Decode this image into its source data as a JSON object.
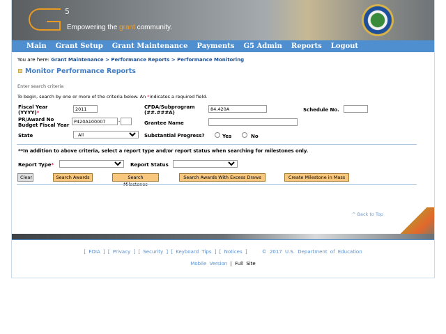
{
  "header": {
    "logo_text": "G5",
    "tagline_pre": "Empowering the ",
    "tagline_accent": "grant",
    "tagline_post": " community.",
    "seal": "U.S. Department of Education seal"
  },
  "nav": [
    "Main",
    "Grant Setup",
    "Grant Maintenance",
    "Payments",
    "G5 Admin",
    "Reports",
    "Logout"
  ],
  "breadcrumb": {
    "prefix": "You are here: ",
    "items": [
      "Grant Maintenance",
      "Performance Reports",
      "Performance Monitoring"
    ],
    "sep": " > "
  },
  "page_title": "Monitor Performance Reports",
  "intro": {
    "heading": "Enter search criteria",
    "text": "To begin, search by one or more of the criteria below.  An ",
    "req_mark": "*",
    "text2": "indicates a required field."
  },
  "form": {
    "fiscal_year": {
      "label1": "Fiscal Year",
      "label2": "(YYYY)",
      "value": "2011"
    },
    "cfda": {
      "label1": "CFDA/Subprogram",
      "label2": "(##.###A)",
      "value": "84.420A"
    },
    "schedule": {
      "label": "Schedule No.",
      "value": ""
    },
    "award": {
      "label1": "PR/Award No",
      "label2": "Budget Fiscal Year",
      "value": "P420A100007",
      "suffix": ""
    },
    "grantee": {
      "label": "Grantee Name",
      "value": ""
    },
    "state": {
      "label": "State",
      "value": "All"
    },
    "progress": {
      "label": "Substantial Progress?",
      "yes": "Yes",
      "no": "No"
    },
    "note": "**In addition to above criteria, select a report type and/or report status when searching for milestones only.",
    "report_type": {
      "label": "Report Type",
      "value": ""
    },
    "report_status": {
      "label": "Report Status",
      "value": ""
    }
  },
  "buttons": {
    "clear": "Clear",
    "search_awards": "Search Awards",
    "search_milestones": "Search Milestones",
    "excess": "Search Awards With Excess Draws",
    "mass": "Create Milestone in Mass"
  },
  "back_to_top": "^ Back to Top",
  "footer": {
    "links": [
      "FOIA",
      "Privacy",
      "Security",
      "Keyboard Tips",
      "Notices"
    ],
    "copyright": "© 2017 U.S. Department of Education",
    "mobile": "Mobile Version",
    "sep": "|",
    "full": "Full Site"
  },
  "colors": {
    "nav": "#4f8fd0",
    "accent": "#f0a22e",
    "title": "#3f7cc5",
    "button": "#f8c77e"
  }
}
